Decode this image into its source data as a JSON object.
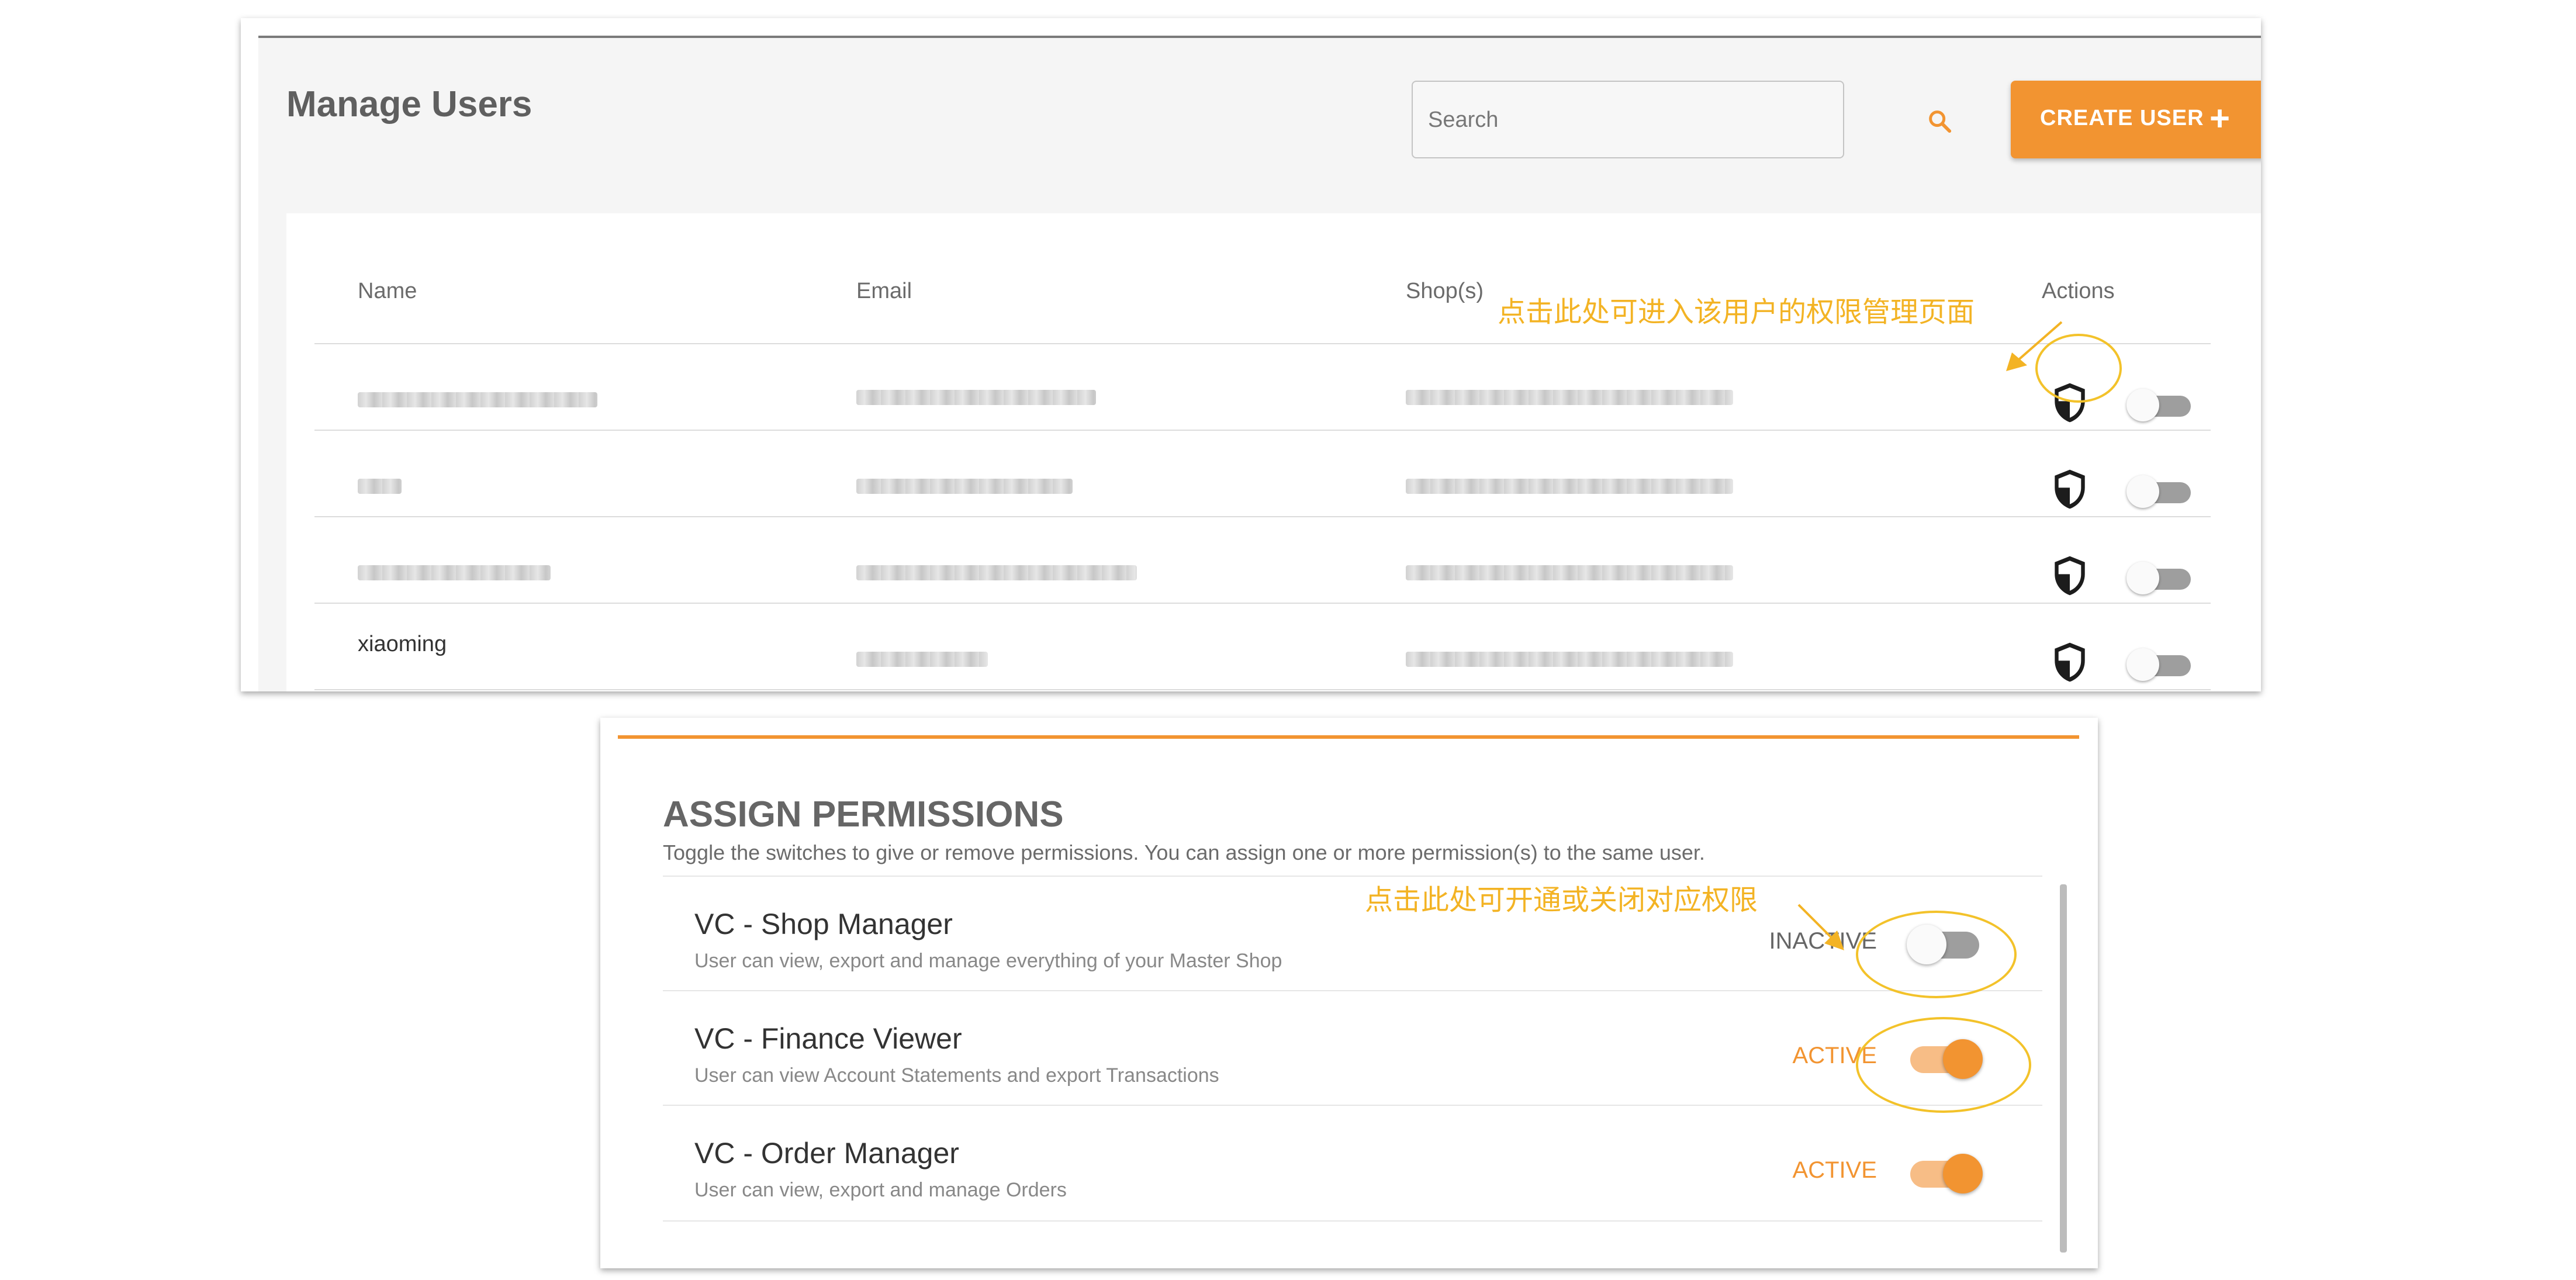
{
  "manage_users": {
    "title": "Manage Users",
    "search": {
      "placeholder": "Search"
    },
    "create_user": {
      "label": "CREATE USER",
      "plus": "+"
    },
    "table": {
      "headers": [
        "Name",
        "Email",
        "Shop(s)",
        "Actions"
      ],
      "rows": [
        {
          "name": "",
          "email": "",
          "shops": ""
        },
        {
          "name": "",
          "email": "",
          "shops": ""
        },
        {
          "name": "",
          "email": "",
          "shops": ""
        },
        {
          "name": "xiaoming",
          "email": "",
          "shops": ""
        }
      ]
    },
    "annotation": "点击此处可进入该用户的权限管理页面"
  },
  "assign_permissions": {
    "title": "ASSIGN PERMISSIONS",
    "subtitle": "Toggle the switches to give or remove permissions. You can assign one or more permission(s) to the same user.",
    "annotation": "点击此处可开通或关闭对应权限",
    "permissions": [
      {
        "name": "VC - Shop Manager",
        "description": "User can view, export and manage everything of your Master Shop",
        "status": "INACTIVE"
      },
      {
        "name": "VC - Finance Viewer",
        "description": "User can view Account Statements and export Transactions",
        "status": "ACTIVE"
      },
      {
        "name": "VC - Order Manager",
        "description": "User can view, export and manage Orders",
        "status": "ACTIVE"
      }
    ]
  },
  "colors": {
    "accent": "#f29431",
    "annotation": "#f3b324",
    "inactive_text": "#666666"
  }
}
